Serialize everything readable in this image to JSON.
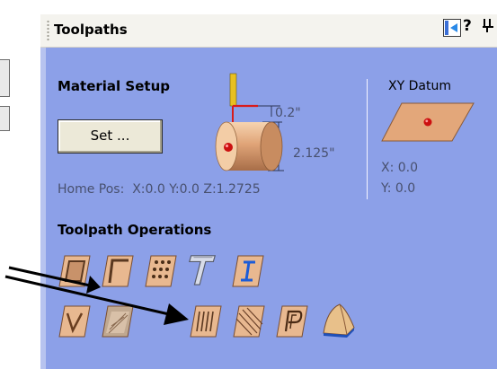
{
  "panel": {
    "title": "Toolpaths",
    "help_label": "?",
    "pin_glyph": "⊣",
    "dock_icon": "dock-panel-icon"
  },
  "material_setup": {
    "heading": "Material Setup",
    "set_button": "Set ...",
    "depth_top": "0.2\"",
    "thickness": "2.125\"",
    "home_pos": "Home Pos:  X:0.0 Y:0.0 Z:1.2725"
  },
  "xy_datum": {
    "heading": "XY Datum",
    "x": "X: 0.0",
    "y": "Y: 0.0"
  },
  "operations": {
    "heading": "Toolpath Operations",
    "row1": [
      "profile-toolpath-icon",
      "pocket-toolpath-icon",
      "drilling-toolpath-icon",
      "inlay-toolpath-icon",
      "quick-engrave-toolpath-icon"
    ],
    "row2": [
      "vcarve-toolpath-icon",
      "prism-carve-toolpath-icon",
      "fluting-toolpath-icon",
      "texture-toolpath-icon",
      "moulding-toolpath-icon",
      "3d-toolpath-icon"
    ]
  },
  "colors": {
    "panel_bg": "#8ca0e8",
    "header_bg": "#f4f3ee",
    "tile_light": "#e8b890",
    "tile_dark": "#a86e48"
  }
}
